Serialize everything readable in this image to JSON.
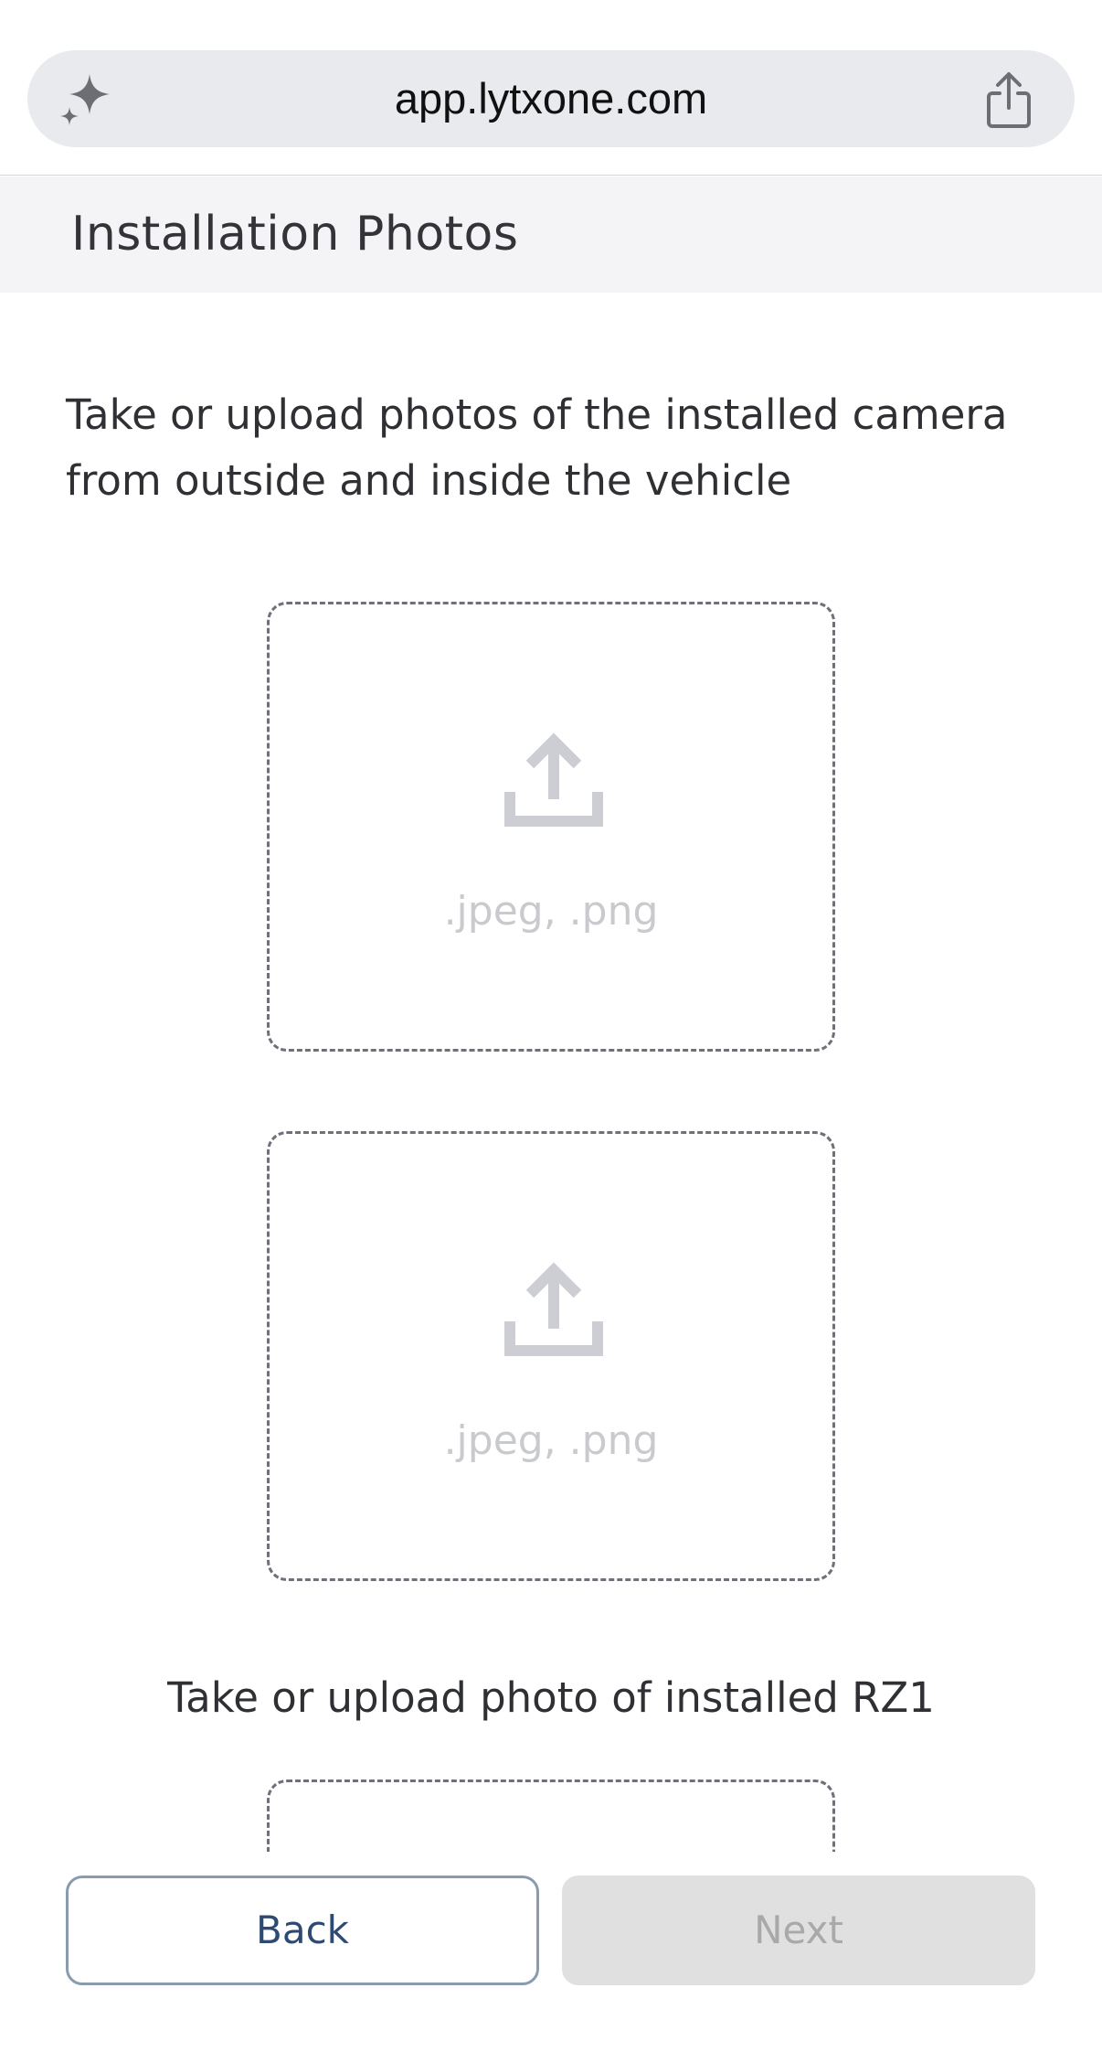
{
  "browser": {
    "url": "app.lytxone.com",
    "left_icon": "sparkle-icon",
    "right_icon": "share-icon"
  },
  "header": {
    "title": "Installation Photos"
  },
  "main": {
    "instructions": "Take or upload photos of the installed camera from outside and inside the vehicle",
    "upload_boxes": [
      {
        "icon": "upload-icon",
        "formats": ".jpeg, .png"
      },
      {
        "icon": "upload-icon",
        "formats": ".jpeg, .png"
      }
    ],
    "rz1_label": "Take or upload photo of installed RZ1"
  },
  "footer": {
    "back_label": "Back",
    "next_label": "Next",
    "next_enabled": false
  },
  "colors": {
    "header_bg": "#f4f4f7",
    "back_text": "#2e4a72",
    "next_disabled_bg": "#e0e0e0",
    "dashed_border": "#6f7079"
  }
}
